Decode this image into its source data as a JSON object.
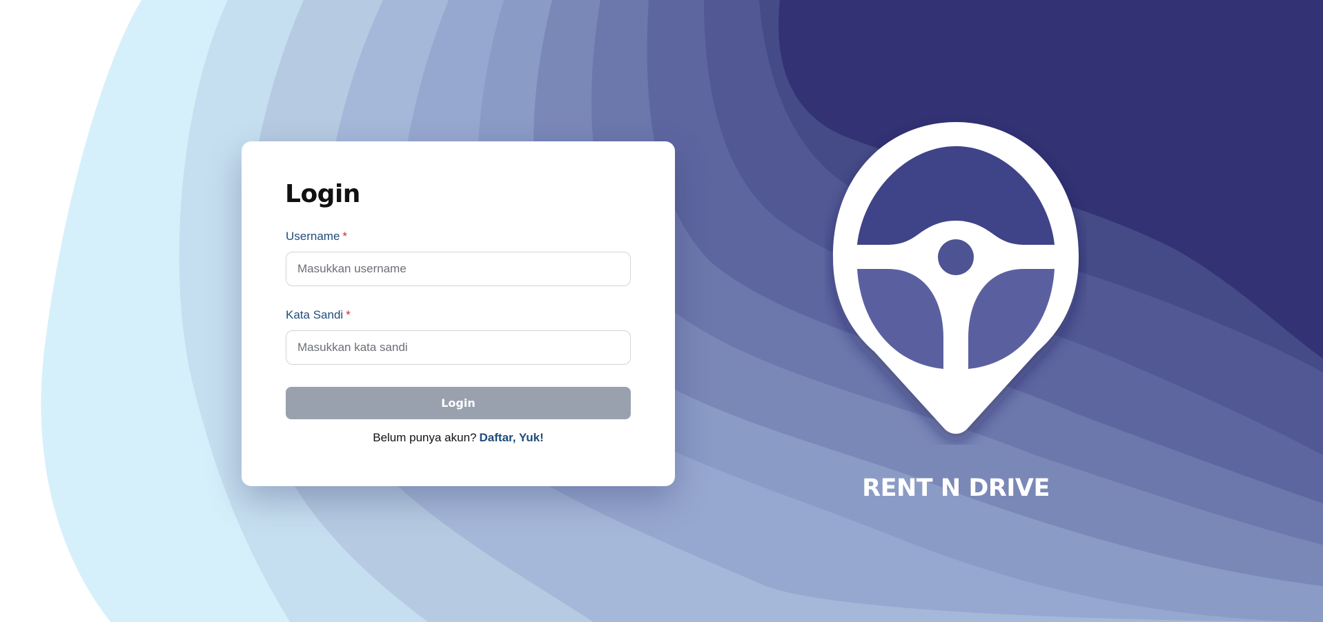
{
  "login_form": {
    "title": "Login",
    "username_label": "Username",
    "username_placeholder": "Masukkan username",
    "username_value": "",
    "password_label": "Kata Sandi",
    "password_placeholder": "Masukkan kata sandi",
    "password_value": "",
    "required_marker": "*",
    "submit_label": "Login",
    "signup_prompt": "Belum punya akun?",
    "signup_link": "Daftar, Yuk!"
  },
  "brand": {
    "name": "RENT N DRIVE",
    "logo_icon": "steering-wheel-location-pin-icon"
  },
  "colors": {
    "label_text": "#1e4c7a",
    "required_marker": "#d0262b",
    "button_disabled": "#9aa1ae",
    "background_dark": "#323274",
    "background_light": "#d6f0fb"
  }
}
